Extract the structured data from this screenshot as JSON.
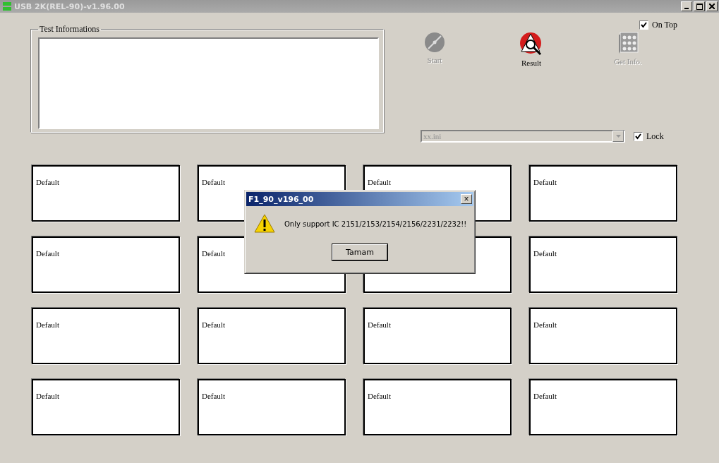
{
  "window": {
    "title": "USB 2K(REL-90)-v1.96.00"
  },
  "on_top": {
    "label": "On Top",
    "checked": true
  },
  "test_info": {
    "title": "Test Informations"
  },
  "toolbar": [
    {
      "kind": "disc",
      "label": "Start",
      "disabled": true
    },
    {
      "kind": "result",
      "label": "Result",
      "disabled": false
    },
    {
      "kind": "info",
      "label": "Get Info.",
      "disabled": true
    }
  ],
  "config": {
    "value": "xx.ini",
    "disabled": true
  },
  "lock": {
    "label": "Lock",
    "checked": true
  },
  "panels": [
    {
      "kind": "labeled",
      "label": "Default"
    },
    {
      "kind": "labeled",
      "label": "Default"
    },
    {
      "kind": "labeled",
      "label": "Default"
    },
    {
      "kind": "labeled",
      "label": "Default"
    },
    {
      "kind": "labeled",
      "label": "Default"
    },
    {
      "kind": "labeled",
      "label": "Default"
    },
    {
      "kind": "blank"
    },
    {
      "kind": "labeled",
      "label": "Default"
    },
    {
      "kind": "labeled",
      "label": "Default"
    },
    {
      "kind": "labeled",
      "label": "Default"
    },
    {
      "kind": "labeled",
      "label": "Default"
    },
    {
      "kind": "labeled",
      "label": "Default"
    },
    {
      "kind": "labeled",
      "label": "Default"
    },
    {
      "kind": "labeled",
      "label": "Default"
    },
    {
      "kind": "labeled",
      "label": "Default"
    },
    {
      "kind": "labeled",
      "label": "Default"
    }
  ],
  "dialog": {
    "title": "F1_90_v196_00",
    "message": "Only support IC  2151/2153/2154/2156/2231/2232!!",
    "button": "Tamam",
    "close": "×"
  }
}
